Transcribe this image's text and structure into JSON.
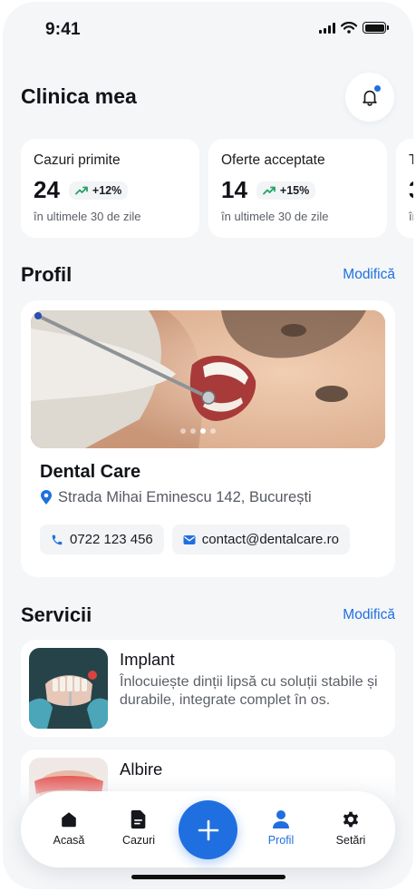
{
  "status_bar": {
    "time": "9:41"
  },
  "header": {
    "title": "Clinica mea"
  },
  "stats": [
    {
      "title": "Cazuri primite",
      "value": "24",
      "trend": "+12%",
      "subtitle": "în ultimele 30 de zile"
    },
    {
      "title": "Oferte acceptate",
      "value": "14",
      "trend": "+15%",
      "subtitle": "în ultimele 30 de zile"
    },
    {
      "title": "T",
      "value": "3",
      "trend": "",
      "subtitle": "în"
    }
  ],
  "profile": {
    "section_title": "Profil",
    "edit_label": "Modifică",
    "clinic_name": "Dental Care",
    "address": "Strada Mihai Eminescu 142, București",
    "phone": "0722 123 456",
    "email": "contact@dentalcare.ro",
    "carousel": {
      "total": 4,
      "active": 2
    }
  },
  "services": {
    "section_title": "Servicii",
    "edit_label": "Modifică",
    "items": [
      {
        "name": "Implant",
        "description": "Înlocuiește dinții lipsă cu soluții stabile și durabile, integrate complet în os."
      },
      {
        "name": "Albire",
        "description": ""
      }
    ]
  },
  "nav": {
    "items": [
      {
        "label": "Acasă",
        "icon": "home-icon"
      },
      {
        "label": "Cazuri",
        "icon": "document-icon"
      },
      {
        "label": "Profil",
        "icon": "user-icon"
      },
      {
        "label": "Setări",
        "icon": "gear-icon"
      }
    ],
    "active": "Profil",
    "add_icon": "plus-icon"
  },
  "colors": {
    "accent": "#1f6fe0",
    "background": "#f4f6f8",
    "trend_up": "#1fa463"
  }
}
